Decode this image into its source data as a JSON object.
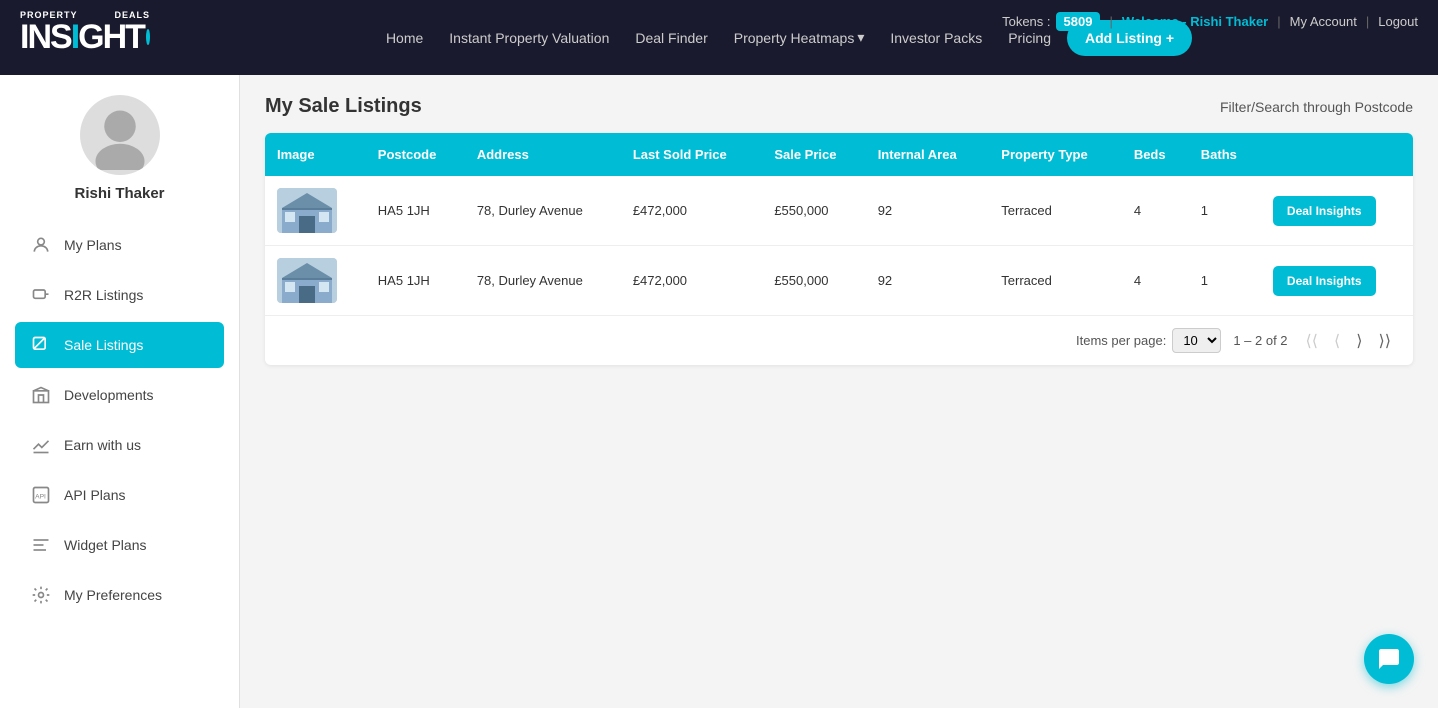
{
  "navbar": {
    "tokens_label": "Tokens :",
    "tokens_value": "5809",
    "welcome_text": "Welcome - Rishi Thaker",
    "my_account": "My Account",
    "logout": "Logout",
    "links": [
      {
        "id": "home",
        "label": "Home"
      },
      {
        "id": "instant-valuation",
        "label": "Instant Property Valuation"
      },
      {
        "id": "deal-finder",
        "label": "Deal Finder"
      },
      {
        "id": "property-heatmaps",
        "label": "Property Heatmaps",
        "has_dropdown": true
      },
      {
        "id": "investor-packs",
        "label": "Investor Packs"
      },
      {
        "id": "pricing",
        "label": "Pricing"
      }
    ],
    "add_listing_btn": "Add Listing +"
  },
  "sidebar": {
    "user_name": "Rishi Thaker",
    "items": [
      {
        "id": "my-plans",
        "label": "My Plans",
        "icon": "user-icon"
      },
      {
        "id": "r2r-listings",
        "label": "R2R Listings",
        "icon": "key-icon"
      },
      {
        "id": "sale-listings",
        "label": "Sale Listings",
        "icon": "tag-icon",
        "active": true
      },
      {
        "id": "developments",
        "label": "Developments",
        "icon": "building-icon"
      },
      {
        "id": "earn-with-us",
        "label": "Earn with us",
        "icon": "chart-icon"
      },
      {
        "id": "api-plans",
        "label": "API Plans",
        "icon": "api-icon"
      },
      {
        "id": "widget-plans",
        "label": "Widget Plans",
        "icon": "widget-icon"
      },
      {
        "id": "my-preferences",
        "label": "My Preferences",
        "icon": "gear-icon"
      }
    ]
  },
  "content": {
    "page_title": "My Sale Listings",
    "filter_label": "Filter/Search through Postcode",
    "table": {
      "headers": [
        "Image",
        "Postcode",
        "Address",
        "Last Sold Price",
        "Sale Price",
        "Internal Area",
        "Property Type",
        "Beds",
        "Baths",
        ""
      ],
      "rows": [
        {
          "postcode": "HA5 1JH",
          "address": "78, Durley Avenue",
          "last_sold_price": "£472,000",
          "sale_price": "£550,000",
          "internal_area": "92",
          "property_type": "Terraced",
          "beds": "4",
          "baths": "1",
          "action_label": "Deal Insights"
        },
        {
          "postcode": "HA5 1JH",
          "address": "78, Durley Avenue",
          "last_sold_price": "£472,000",
          "sale_price": "£550,000",
          "internal_area": "92",
          "property_type": "Terraced",
          "beds": "4",
          "baths": "1",
          "action_label": "Deal Insights"
        }
      ]
    },
    "pagination": {
      "items_per_page_label": "Items per page:",
      "items_per_page_value": "10",
      "page_info": "1 – 2 of 2"
    }
  }
}
